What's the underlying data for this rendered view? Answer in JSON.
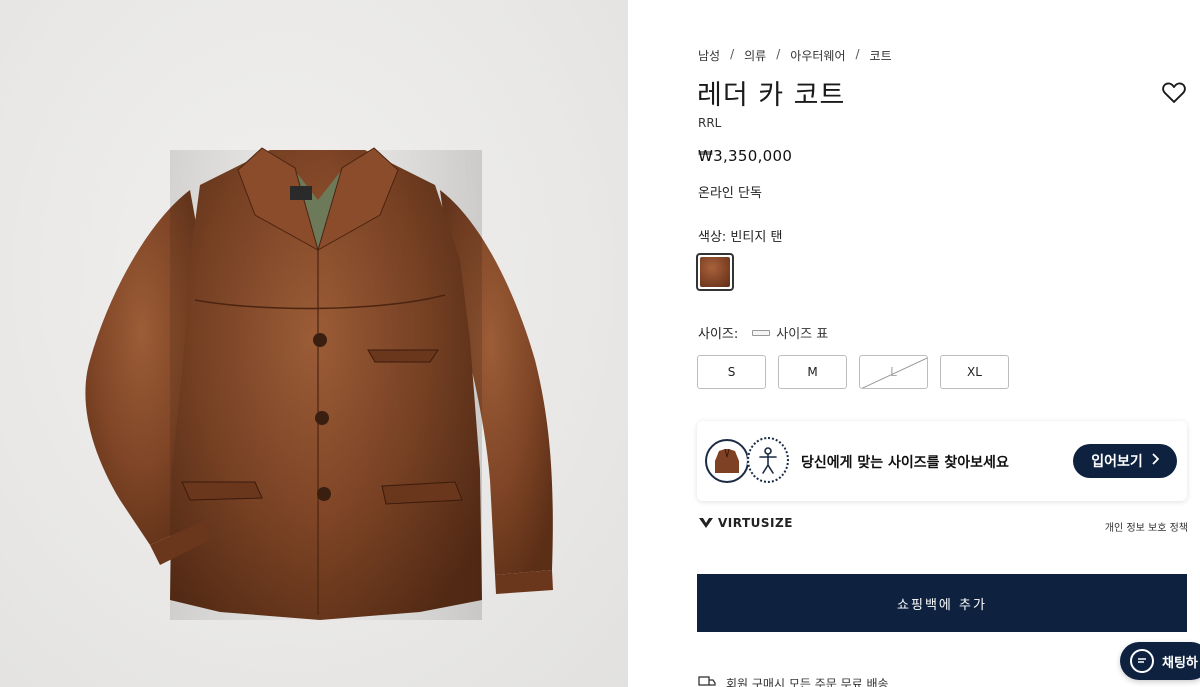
{
  "breadcrumb": [
    "남성",
    "의류",
    "아우터웨어",
    "코트"
  ],
  "breadcrumb_separator": "/",
  "product": {
    "title": "레더 카 코트",
    "brand": "RRL",
    "price": "₩3,350,000",
    "availability": "온라인 단독"
  },
  "color": {
    "label": "색상: 빈티지 탠",
    "swatch_hex": "#7e4124"
  },
  "size": {
    "label": "사이즈:",
    "chart_label": "사이즈 표",
    "options": [
      {
        "label": "S",
        "available": true
      },
      {
        "label": "M",
        "available": true
      },
      {
        "label": "L",
        "available": false
      },
      {
        "label": "XL",
        "available": true
      }
    ]
  },
  "virtusize": {
    "prompt": "당신에게 맞는 사이즈를 찾아보세요",
    "button_label": "입어보기",
    "logo_text": "VIRTUSIZE",
    "privacy_label": "개인 정보 보호 정책"
  },
  "actions": {
    "add_to_bag": "쇼핑백에 추가",
    "chat_label": "채팅하"
  },
  "footer_note": "회원 구매시 모든 주문 무료 배송",
  "icons": {
    "wishlist": "heart-icon",
    "chat": "chat-icon",
    "delivery": "delivery-icon",
    "chevron": "chevron-right-icon"
  },
  "colors": {
    "navy": "#0e2240",
    "background": "#ffffff",
    "image_bg": "#ebeae8"
  }
}
